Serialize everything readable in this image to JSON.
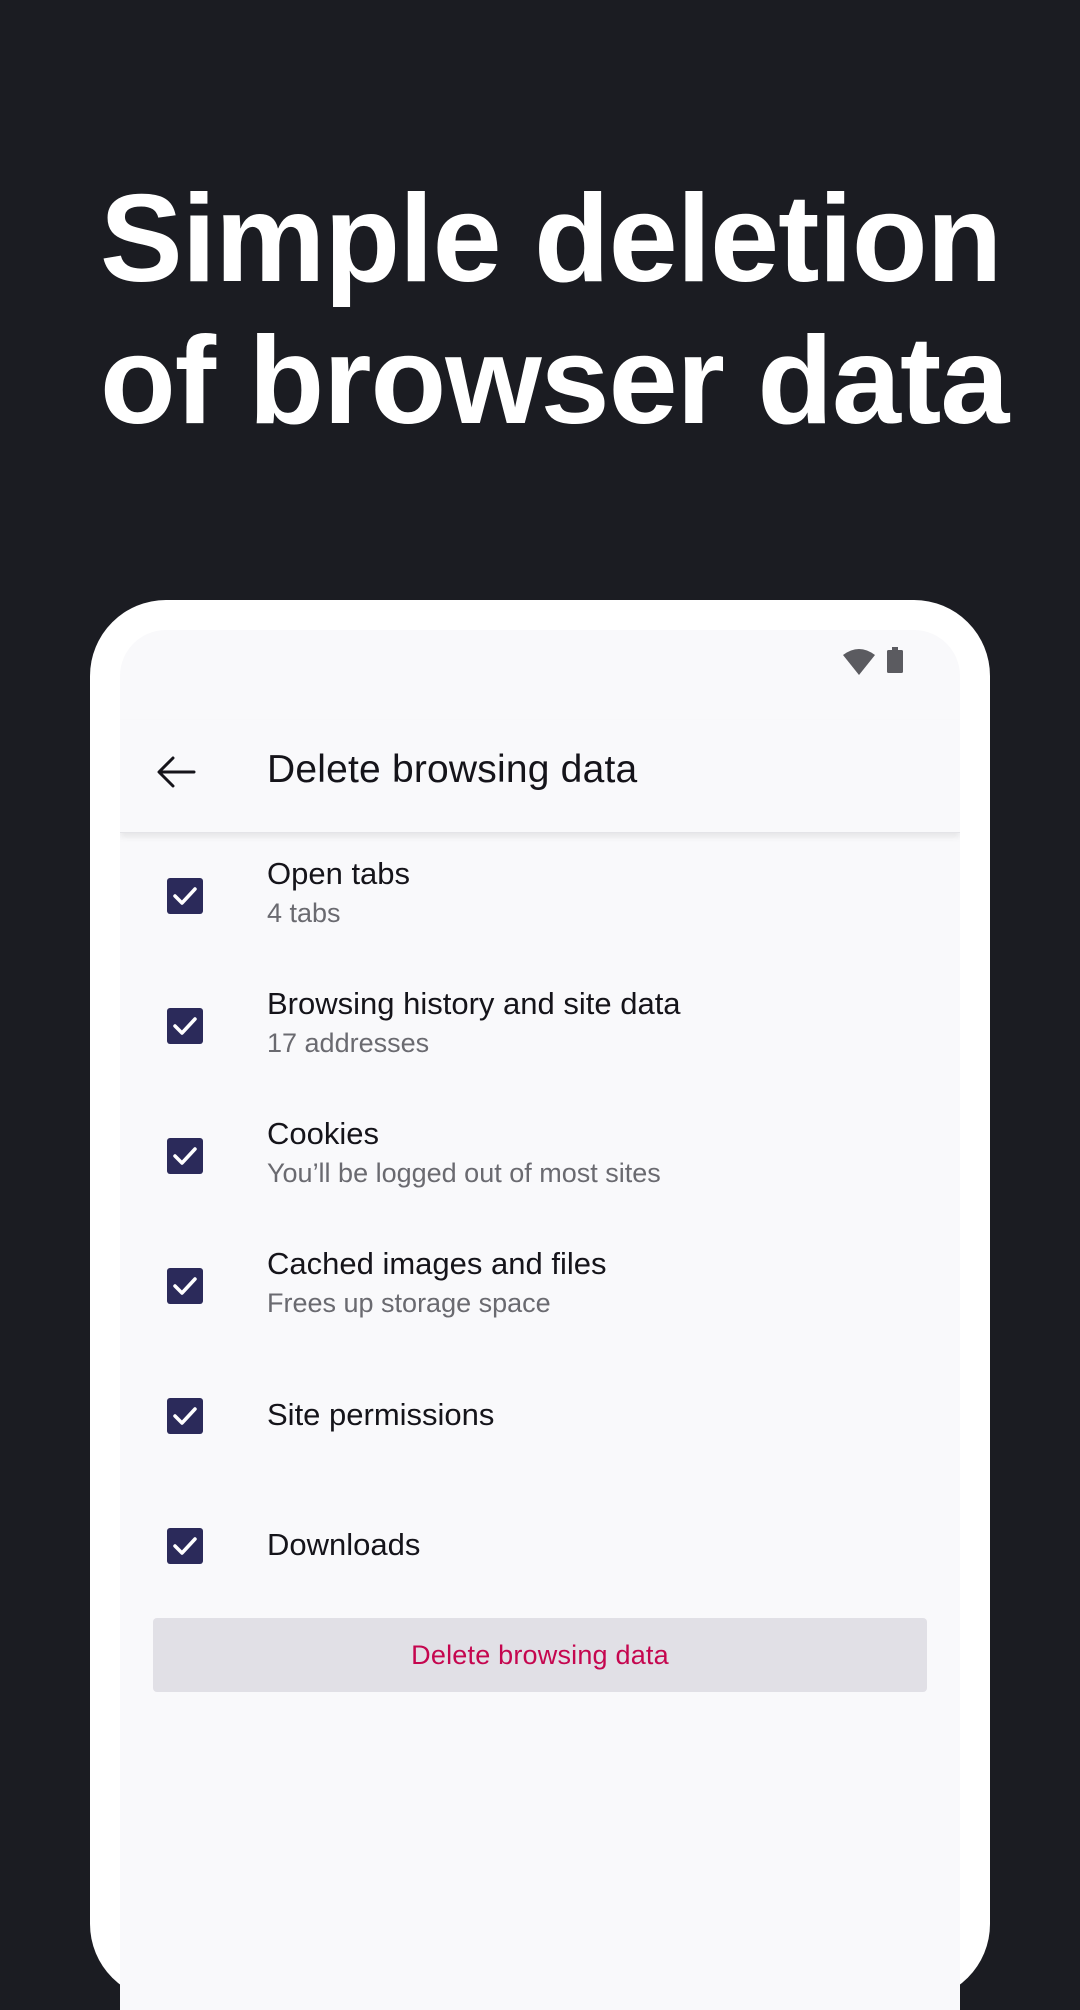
{
  "headline": {
    "line1": "Simple deletion",
    "line2": "of browser data"
  },
  "status_bar": {
    "icons": [
      "wifi-icon",
      "battery-icon"
    ]
  },
  "app_bar": {
    "back_icon": "arrow-left-icon",
    "title": "Delete browsing data"
  },
  "options": [
    {
      "label": "Open tabs",
      "sub": "4 tabs",
      "checked": true
    },
    {
      "label": "Browsing history and site data",
      "sub": "17 addresses",
      "checked": true
    },
    {
      "label": "Cookies",
      "sub": "You’ll be logged out of most sites",
      "checked": true
    },
    {
      "label": "Cached images and files",
      "sub": "Frees up storage space",
      "checked": true
    },
    {
      "label": "Site permissions",
      "checked": true
    },
    {
      "label": "Downloads",
      "checked": true
    }
  ],
  "delete_button": {
    "label": "Delete browsing data"
  },
  "colors": {
    "page_background": "#1b1c22",
    "checkbox": "#2b2a5a",
    "delete_text": "#c5064f",
    "button_background": "#e1e0e6"
  }
}
